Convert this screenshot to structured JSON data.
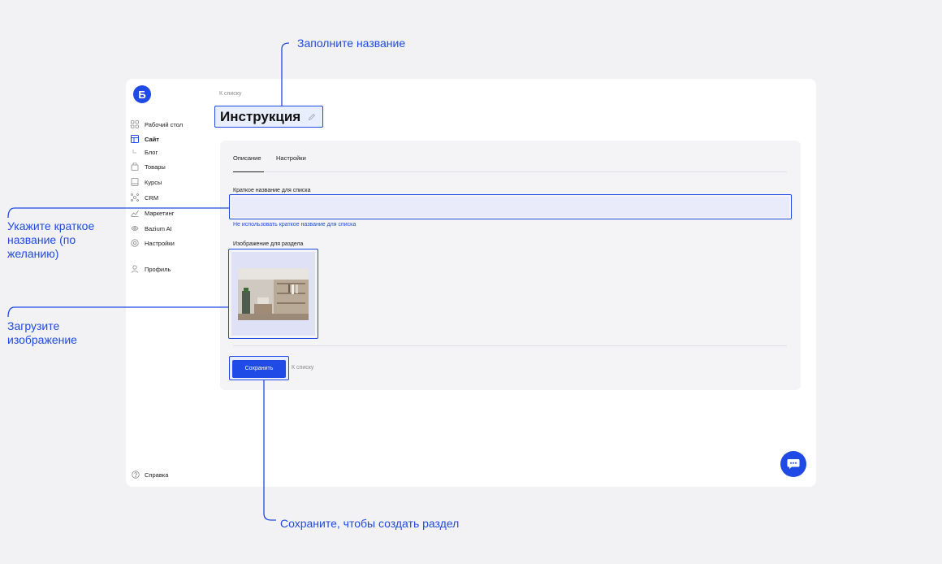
{
  "app": {
    "logo_letter": "Б"
  },
  "sidebar": {
    "items": [
      {
        "label": "Рабочий стол",
        "icon": "grid-icon"
      },
      {
        "label": "Сайт",
        "icon": "layout-icon",
        "active": true
      },
      {
        "label": "Блог",
        "icon": "sub-arrow-icon"
      },
      {
        "label": "Товары",
        "icon": "bag-icon"
      },
      {
        "label": "Курсы",
        "icon": "book-icon"
      },
      {
        "label": "CRM",
        "icon": "network-icon"
      },
      {
        "label": "Маркетинг",
        "icon": "chart-icon"
      },
      {
        "label": "Bazium AI",
        "icon": "ai-icon"
      },
      {
        "label": "Настройки",
        "icon": "gear-icon"
      },
      {
        "label": "Профиль",
        "icon": "user-icon"
      }
    ],
    "help_label": "Справка"
  },
  "header": {
    "breadcrumb": "К списку",
    "title": "Инструкция"
  },
  "tabs": [
    {
      "label": "Описание",
      "active": true
    },
    {
      "label": "Настройки",
      "active": false
    }
  ],
  "form": {
    "short_name_label": "Краткое название для списка",
    "short_name_value": "",
    "no_short_name_link": "Не использовать краткое название для списка",
    "image_label": "Изображение для раздела",
    "save_label": "Сохранить",
    "back_label": "К списку"
  },
  "callouts": {
    "title": "Заполните название",
    "short_name": "Укажите краткое название (по желанию)",
    "image": "Загрузите изображение",
    "save": "Сохраните, чтобы создать раздел"
  },
  "colors": {
    "accent": "#1f4ae5",
    "background": "#f2f2f4",
    "card": "#f4f4f6"
  }
}
